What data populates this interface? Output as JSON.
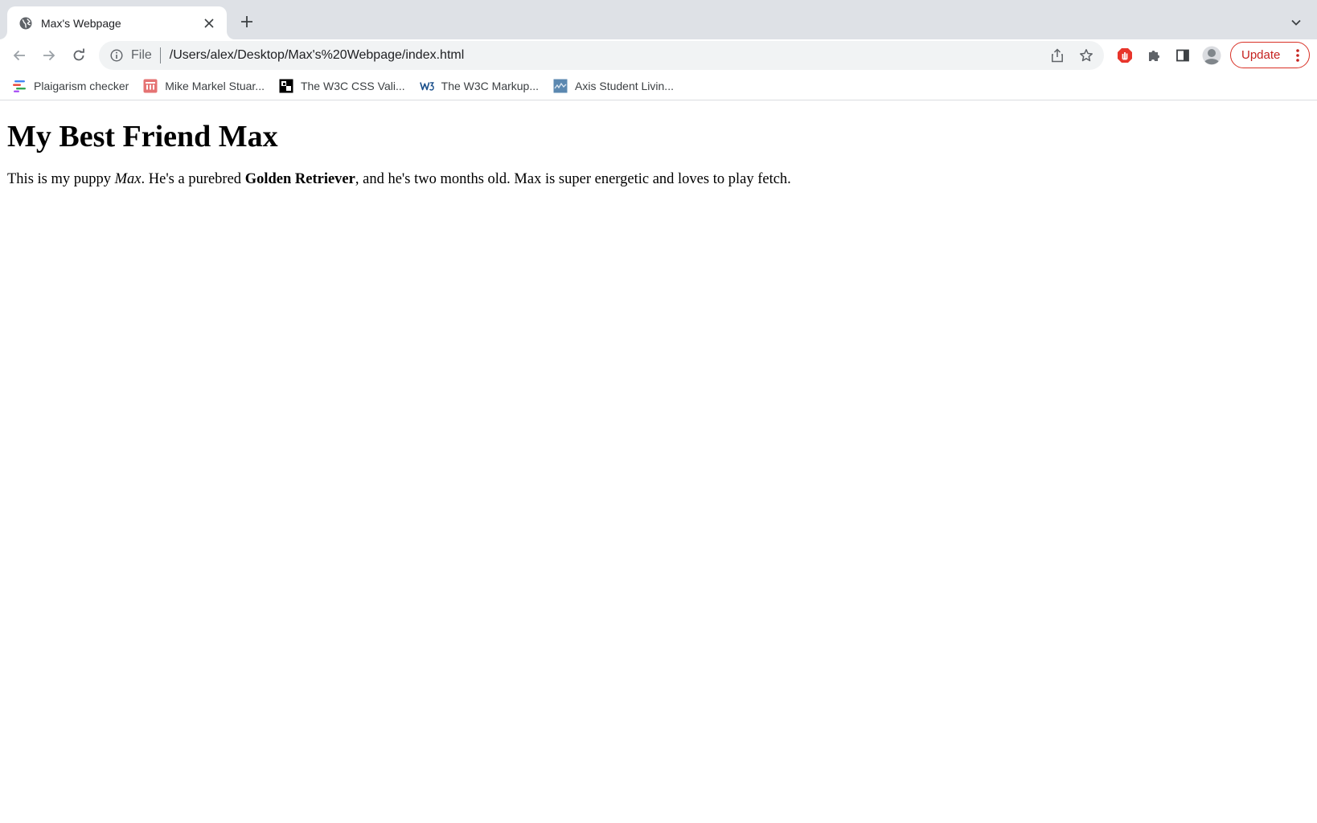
{
  "browser": {
    "tab": {
      "title": "Max's Webpage"
    },
    "address_bar": {
      "scheme_label": "File",
      "url": "/Users/alex/Desktop/Max's%20Webpage/index.html"
    },
    "update_button": {
      "label": "Update"
    },
    "bookmarks": [
      {
        "label": "Plaigarism checker",
        "icon": "plagiarism-checker-icon"
      },
      {
        "label": "Mike Markel Stuar...",
        "icon": "mike-markel-icon"
      },
      {
        "label": "The W3C CSS Vali...",
        "icon": "w3c-css-validator-icon"
      },
      {
        "label": "The W3C Markup...",
        "icon": "w3c-markup-validator-icon"
      },
      {
        "label": "Axis Student Livin...",
        "icon": "axis-student-living-icon"
      }
    ],
    "colors": {
      "accent_red": "#d93025",
      "tab_strip": "#dee1e6",
      "omnibox": "#f1f3f4"
    }
  },
  "page": {
    "heading": "My Best Friend Max",
    "paragraph": {
      "part1": "This is my puppy ",
      "name_italic": "Max",
      "part2": ". He's a purebred ",
      "breed_bold": "Golden Retriever",
      "part3": ", and he's two months old. Max is super energetic and loves to play fetch."
    }
  }
}
